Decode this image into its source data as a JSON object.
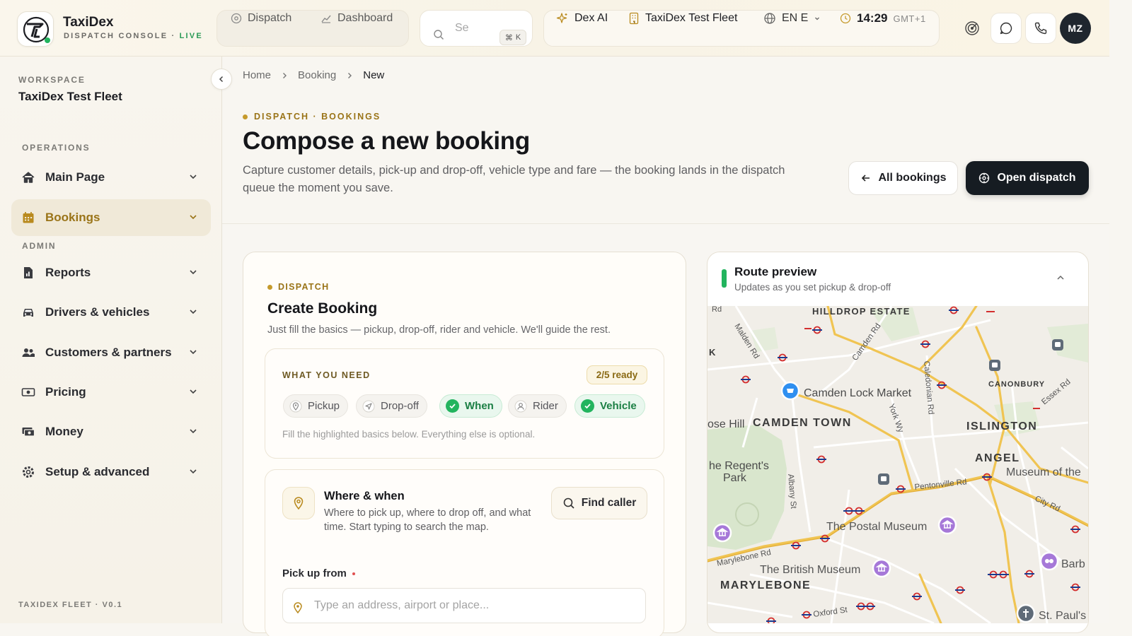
{
  "brand": {
    "name": "TaxiDex",
    "subtitle": "DISPATCH CONSOLE · ",
    "live": "LIVE"
  },
  "topnav": [
    {
      "label": "Dispatch",
      "icon": "dispatch-icon"
    },
    {
      "label": "Dashboard",
      "icon": "chart-icon"
    }
  ],
  "search": {
    "placeholder": "Se",
    "shortcut": "K"
  },
  "tools": {
    "ai": "Dex AI",
    "fleet": "TaxiDex Test Fleet",
    "language": "EN E",
    "time": "14:29",
    "timezone": "GMT+1"
  },
  "user": {
    "initials": "MZ"
  },
  "sidebar": {
    "workspace_label": "WORKSPACE",
    "workspace_name": "TaxiDex Test Fleet",
    "operations_label": "OPERATIONS",
    "admin_label": "ADMIN",
    "items": [
      {
        "label": "Main Page",
        "icon": "home-icon"
      },
      {
        "label": "Bookings",
        "icon": "calendar-icon",
        "active": true
      },
      {
        "label": "Reports",
        "icon": "report-icon"
      },
      {
        "label": "Drivers & vehicles",
        "icon": "car-icon"
      },
      {
        "label": "Customers & partners",
        "icon": "users-icon"
      },
      {
        "label": "Pricing",
        "icon": "money-icon"
      },
      {
        "label": "Money",
        "icon": "cash-icon"
      },
      {
        "label": "Setup & advanced",
        "icon": "gear-icon"
      }
    ],
    "footer": "TAXIDEX FLEET · V0.1"
  },
  "breadcrumb": [
    "Home",
    "Booking",
    "New"
  ],
  "page": {
    "kicker": "DISPATCH · BOOKINGS",
    "title": "Compose a new booking",
    "description": "Capture customer details, pick-up and drop-off, vehicle type and fare — the booking lands in the dispatch queue the moment you save.",
    "all_bookings": "All bookings",
    "open_dispatch": "Open dispatch"
  },
  "booking": {
    "kicker": "DISPATCH",
    "title": "Create Booking",
    "description": "Just fill the basics — pickup, drop-off, rider and vehicle. We'll guide the rest.",
    "needs_label": "WHAT YOU NEED",
    "ready": "2/5 ready",
    "requirements": [
      {
        "label": "Pickup",
        "done": false
      },
      {
        "label": "Drop-off",
        "done": false
      },
      {
        "label": "When",
        "done": true
      },
      {
        "label": "Rider",
        "done": false
      },
      {
        "label": "Vehicle",
        "done": true
      }
    ],
    "needs_hint": "Fill the highlighted basics below. Everything else is optional.",
    "where_title": "Where & when",
    "where_desc": "Where to pick up, where to drop off, and what time. Start typing to search the map.",
    "find_caller": "Find caller",
    "pickup_label": "Pick up from",
    "pickup_placeholder": "Type an address, airport or place..."
  },
  "route": {
    "title": "Route preview",
    "subtitle": "Updates as you set pickup & drop-off",
    "map_labels": {
      "hilldrop": "HILLDROP ESTATE",
      "camden_lock": "Camden Lock Market",
      "camden_town": "CAMDEN TOWN",
      "canonbury": "CANONBURY",
      "islington": "ISLINGTON",
      "angel": "ANGEL",
      "museum_of_the": "Museum of the",
      "regents_park": "he Regent's",
      "regents_park2": "Park",
      "rose_hill": "ose Hill",
      "postal_museum": "The Postal Museum",
      "british_museum": "The British Museum",
      "marylebone": "MARYLEBONE",
      "barb": "Barb",
      "st_pauls": "St. Paul's",
      "malden_rd": "Malden Rd",
      "camden_rd": "Camden Rd",
      "caledonian_rd": "Caledonian Rd",
      "york_wy": "York Wy",
      "essex_rd": "Essex Rd",
      "albany_st": "Albany St",
      "pentonville_rd": "Pentonville Rd",
      "city_rd": "City Rd",
      "marylebone_rd": "Marylebone Rd",
      "oxford_st": "Oxford St",
      "rd_frag": "Rd",
      "k_frag": "K"
    }
  },
  "colors": {
    "accent_gold": "#9a7418",
    "success": "#22b45e",
    "dark": "#161c22"
  }
}
